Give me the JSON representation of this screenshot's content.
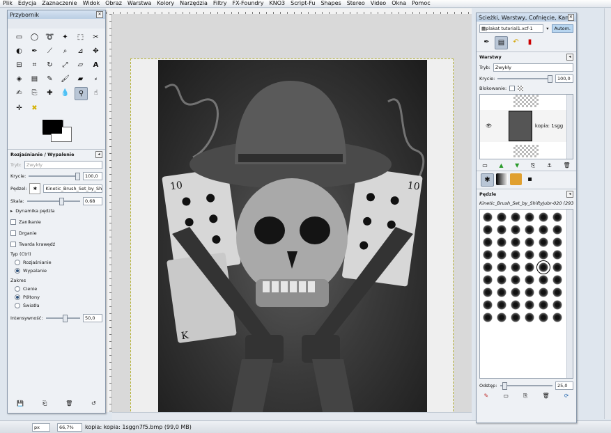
{
  "menu": [
    "Plik",
    "Edycja",
    "Zaznaczenie",
    "Widok",
    "Obraz",
    "Warstwa",
    "Kolory",
    "Narzędzia",
    "Filtry",
    "FX-Foundry",
    "KNO3",
    "Script-Fu",
    "Shapes",
    "Stereo",
    "Video",
    "Okna",
    "Pomoc"
  ],
  "toolbox": {
    "title": "Przybornik",
    "options_title": "Rozjaśnianie / Wypalenie",
    "mode_label": "Tryb:",
    "mode_value": "Zwykły",
    "opacity_label": "Krycie:",
    "opacity_value": "100,0",
    "brush_label": "Pędzel:",
    "brush_value": "Kinetic_Brush_Set_by_Shift",
    "scale_label": "Skala:",
    "scale_value": "0,68",
    "dynamics_label": "Dynamika pędzla",
    "fade_label": "Zanikanie",
    "jitter_label": "Drganie",
    "hard_edge_label": "Twarda krawędź",
    "type_label": "Typ  (Ctrl)",
    "type_options": [
      "Rozjaśnianie",
      "Wypalanie"
    ],
    "type_selected": 1,
    "range_label": "Zakres",
    "range_options": [
      "Cienie",
      "Półtony",
      "Światła"
    ],
    "range_selected": 1,
    "exposure_label": "Intensywność:",
    "exposure_value": "50,0"
  },
  "status": {
    "unit": "px",
    "zoom": "66,7%",
    "message": "kopia: kopia: 1sggn7f5.bmp (99,0 MB)"
  },
  "dock": {
    "title": "Ścieżki, Warstwy, Cofnięcie, Kana...",
    "image_select": "plakat tutorial1.xcf-1",
    "auto_button": "Autom.",
    "layers_title": "Warstwy",
    "mode_label": "Tryb:",
    "mode_value": "Zwykły",
    "opacity_label": "Krycie:",
    "opacity_value": "100,0",
    "lock_label": "Blokowanie:",
    "layer_name": "kopia: 1sgg",
    "brushes_title": "Pędzle",
    "brush_name": "Kinetic_Brush_Set_by_ShiftyJubr-020 (293 ...",
    "spacing_label": "Odstęp:",
    "spacing_value": "25,0"
  }
}
